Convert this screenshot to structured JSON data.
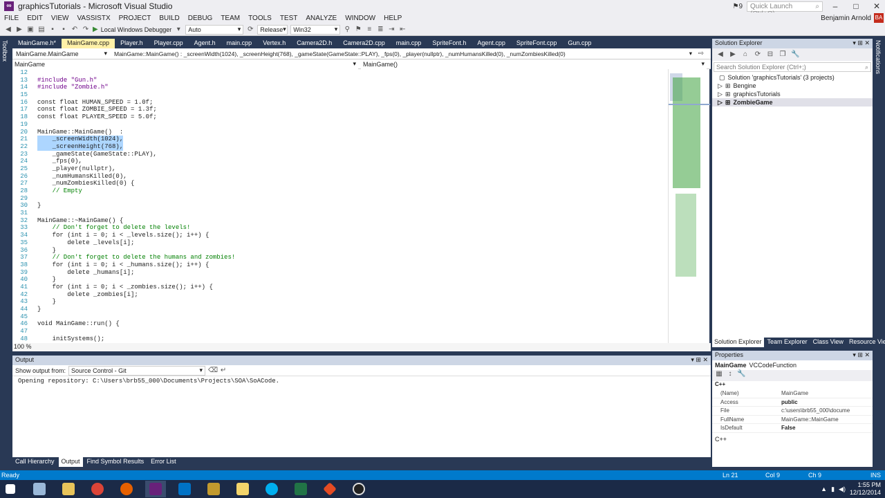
{
  "window": {
    "title": "graphicsTutorials - Microsoft Visual Studio",
    "notifications_count": "9",
    "quick_launch_placeholder": "Quick Launch (Ctrl+Q)",
    "user": "Benjamin Arnold",
    "avatar_initials": "BA"
  },
  "menu": [
    "FILE",
    "EDIT",
    "VIEW",
    "VASSISTX",
    "PROJECT",
    "BUILD",
    "DEBUG",
    "TEAM",
    "TOOLS",
    "TEST",
    "ANALYZE",
    "WINDOW",
    "HELP"
  ],
  "toolbar": {
    "debugger": "Local Windows Debugger",
    "config_auto": "Auto",
    "config": "Release",
    "platform": "Win32"
  },
  "side_tabs": {
    "left": "Toolbox",
    "right": "Notifications"
  },
  "doc_tabs": [
    "MainGame.h*",
    "MainGame.cpp",
    "Player.h",
    "Player.cpp",
    "Agent.h",
    "main.cpp",
    "Vertex.h",
    "Camera2D.h",
    "Camera2D.cpp",
    "main.cpp",
    "SpriteFont.h",
    "Agent.cpp",
    "SpriteFont.cpp",
    "Gun.cpp"
  ],
  "nav": {
    "class_scope": "MainGame.MainGame",
    "member": "MainGame::MainGame() : _screenWidth(1024), _screenHeight(768), _gameState(GameState::PLAY), _fps(0), _player(nullptr), _numHumansKilled(0), _numZombiesKilled(0)",
    "scope2": "MainGame",
    "func2": "MainGame()"
  },
  "code_lines": [
    {
      "n": "12",
      "t": ""
    },
    {
      "n": "13",
      "t": "#include \"Gun.h\""
    },
    {
      "n": "14",
      "t": "#include \"Zombie.h\""
    },
    {
      "n": "15",
      "t": ""
    },
    {
      "n": "16",
      "t": "const float HUMAN_SPEED = 1.0f;"
    },
    {
      "n": "17",
      "t": "const float ZOMBIE_SPEED = 1.3f;"
    },
    {
      "n": "18",
      "t": "const float PLAYER_SPEED = 5.0f;"
    },
    {
      "n": "19",
      "t": ""
    },
    {
      "n": "20",
      "t": "MainGame::MainGame()  :"
    },
    {
      "n": "21",
      "t": "    _screenWidth(1024),"
    },
    {
      "n": "22",
      "t": "    _screenHeight(768),"
    },
    {
      "n": "23",
      "t": "    _gameState(GameState::PLAY),"
    },
    {
      "n": "24",
      "t": "    _fps(0),"
    },
    {
      "n": "25",
      "t": "    _player(nullptr),"
    },
    {
      "n": "26",
      "t": "    _numHumansKilled(0),"
    },
    {
      "n": "27",
      "t": "    _numZombiesKilled(0) {"
    },
    {
      "n": "28",
      "t": "    // Empty"
    },
    {
      "n": "29",
      "t": ""
    },
    {
      "n": "30",
      "t": "}"
    },
    {
      "n": "31",
      "t": ""
    },
    {
      "n": "32",
      "t": "MainGame::~MainGame() {"
    },
    {
      "n": "33",
      "t": "    // Don't forget to delete the levels!"
    },
    {
      "n": "34",
      "t": "    for (int i = 0; i < _levels.size(); i++) {"
    },
    {
      "n": "35",
      "t": "        delete _levels[i];"
    },
    {
      "n": "36",
      "t": "    }"
    },
    {
      "n": "37",
      "t": "    // Don't forget to delete the humans and zombies!"
    },
    {
      "n": "38",
      "t": "    for (int i = 0; i < _humans.size(); i++) {"
    },
    {
      "n": "39",
      "t": "        delete _humans[i];"
    },
    {
      "n": "40",
      "t": "    }"
    },
    {
      "n": "41",
      "t": "    for (int i = 0; i < _zombies.size(); i++) {"
    },
    {
      "n": "42",
      "t": "        delete _zombies[i];"
    },
    {
      "n": "43",
      "t": "    }"
    },
    {
      "n": "44",
      "t": "}"
    },
    {
      "n": "45",
      "t": ""
    },
    {
      "n": "46",
      "t": "void MainGame::run() {"
    },
    {
      "n": "47",
      "t": ""
    },
    {
      "n": "48",
      "t": "    initSystems();"
    }
  ],
  "zoom": "100 %",
  "output": {
    "title": "Output",
    "show_from_label": "Show output from:",
    "source": "Source Control - Git",
    "text": "Opening repository: C:\\Users\\brb55_000\\Documents\\Projects\\SOA\\SoACode."
  },
  "bottom_tabs": [
    "Call Hierarchy",
    "Output",
    "Find Symbol Results",
    "Error List"
  ],
  "solution_explorer": {
    "title": "Solution Explorer",
    "search_placeholder": "Search Solution Explorer (Ctrl+;)",
    "solution": "Solution 'graphicsTutorials' (3 projects)",
    "projects": [
      "Bengine",
      "graphicsTutorials",
      "ZombieGame"
    ]
  },
  "se_tabs": [
    "Solution Explorer",
    "Team Explorer",
    "Class View",
    "Resource View"
  ],
  "properties": {
    "title": "Properties",
    "object": "MainGame",
    "object_type": "VCCodeFunction",
    "category": "C++",
    "rows": [
      {
        "k": "(Name)",
        "v": "MainGame"
      },
      {
        "k": "Access",
        "v": "public"
      },
      {
        "k": "File",
        "v": "c:\\users\\brb55_000\\docume"
      },
      {
        "k": "FullName",
        "v": "MainGame::MainGame"
      },
      {
        "k": "IsDefault",
        "v": "False"
      }
    ],
    "footer": "C++"
  },
  "status": {
    "ready": "Ready",
    "ln": "Ln 21",
    "col": "Col 9",
    "ch": "Ch 9",
    "ins": "INS"
  },
  "taskbar": {
    "time": "1:55 PM",
    "date": "12/12/2014"
  }
}
